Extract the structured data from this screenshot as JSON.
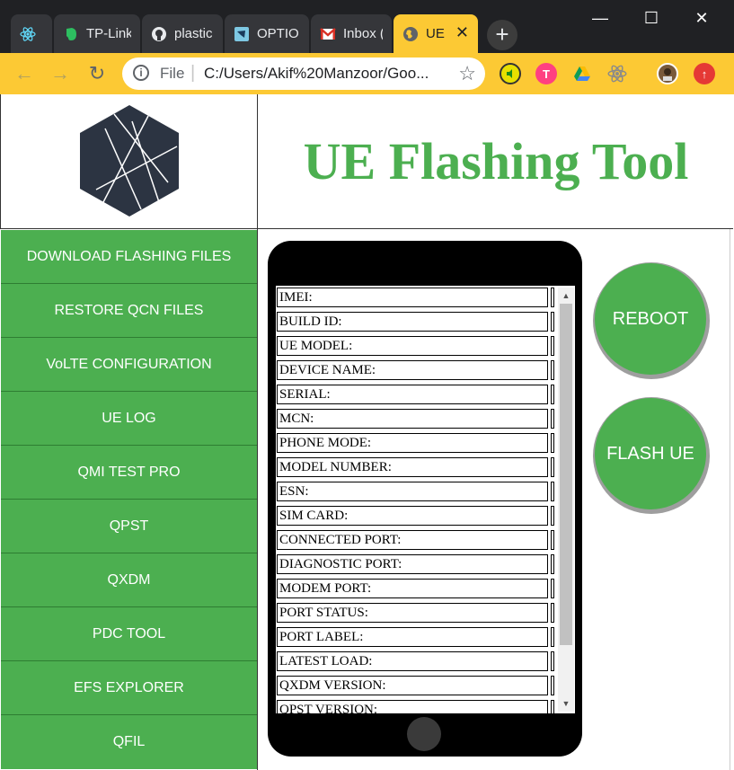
{
  "browser": {
    "tabs": [
      {
        "title": "",
        "icon": "react-icon"
      },
      {
        "title": "TP-Link",
        "icon": "evernote-icon"
      },
      {
        "title": "plastic",
        "icon": "github-icon"
      },
      {
        "title": "OPTIO",
        "icon": "app-icon"
      },
      {
        "title": "Inbox (",
        "icon": "gmail-icon"
      },
      {
        "title": "UE",
        "icon": "globe-icon",
        "active": true
      }
    ],
    "new_tab_label": "+",
    "window_controls": {
      "minimize": "—",
      "maximize": "☐",
      "close": "✕"
    },
    "address": {
      "scheme_label": "File",
      "separator": "|",
      "url": "C:/Users/Akif%20Manzoor/Goo..."
    },
    "accent_color": "#fcc934"
  },
  "page": {
    "title": "UE Flashing Tool",
    "title_color": "#4caf50",
    "menu": [
      "DOWNLOAD FLASHING FILES",
      "RESTORE QCN FILES",
      "VoLTE CONFIGURATION",
      "UE LOG",
      "QMI TEST PRO",
      "QPST",
      "QXDM",
      "PDC TOOL",
      "EFS EXPLORER",
      "QFIL"
    ],
    "device_fields": [
      "IMEI:",
      "BUILD ID:",
      "UE MODEL:",
      "DEVICE NAME:",
      "SERIAL:",
      "MCN:",
      "PHONE MODE:",
      "MODEL NUMBER:",
      "ESN:",
      "SIM CARD:",
      "CONNECTED PORT:",
      "DIAGNOSTIC PORT:",
      "MODEM PORT:",
      "PORT STATUS:",
      "PORT LABEL:",
      "LATEST LOAD:",
      "QXDM VERSION:",
      "QPST VERSION:"
    ],
    "buttons": {
      "reboot": "REBOOT",
      "flash": "FLASH UE"
    }
  }
}
